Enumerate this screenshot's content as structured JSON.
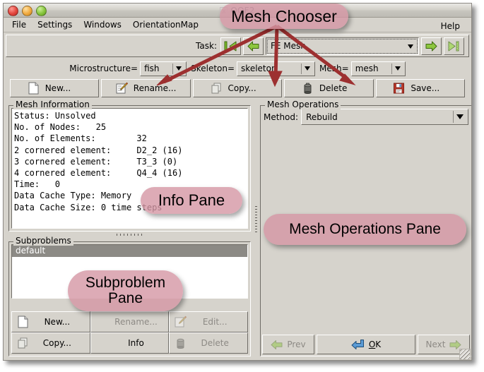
{
  "window": {
    "title_icon": "x-icon",
    "title": "OOF2",
    "lights": [
      "close-light",
      "minimize-light",
      "maximize-light"
    ]
  },
  "menubar": {
    "items": [
      {
        "label": "File",
        "name": "menu-file"
      },
      {
        "label": "Settings",
        "name": "menu-settings"
      },
      {
        "label": "Windows",
        "name": "menu-windows"
      },
      {
        "label": "OrientationMap",
        "name": "menu-orientationmap"
      }
    ],
    "help": "Help"
  },
  "task_bar": {
    "label": "Task:",
    "value": "FE Mesh",
    "buttons": [
      {
        "name": "task-first-button",
        "icon": "arrow-first-icon"
      },
      {
        "name": "task-prev-button",
        "icon": "arrow-left-icon"
      },
      {
        "name": "task-next-button",
        "icon": "arrow-right-icon"
      },
      {
        "name": "task-last-button",
        "icon": "arrow-last-icon"
      }
    ]
  },
  "choosers": [
    {
      "label": "Microstructure=",
      "value": "fish",
      "name": "microstructure-chooser",
      "width": 66
    },
    {
      "label": "Skeleton=",
      "value": "skeleton",
      "name": "skeleton-chooser",
      "width": 111
    },
    {
      "label": "Mesh=",
      "value": "mesh",
      "name": "mesh-chooser",
      "width": 77
    }
  ],
  "mesh_buttons": [
    {
      "label": "New...",
      "icon": "new-document-icon",
      "name": "mesh-new-button"
    },
    {
      "label": "Rename...",
      "icon": "pencil-edit-icon",
      "name": "mesh-rename-button"
    },
    {
      "label": "Copy...",
      "icon": "copy-icon",
      "name": "mesh-copy-button",
      "disabled": true
    },
    {
      "label": "Delete",
      "icon": "trash-icon",
      "name": "mesh-delete-button"
    },
    {
      "label": "Save...",
      "icon": "floppy-save-icon",
      "name": "mesh-save-button"
    }
  ],
  "mesh_information": {
    "legend": "Mesh Information",
    "text": "Status: Unsolved\nNo. of Nodes:   25\nNo. of Elements:        32\n2 cornered element:     D2_2 (16)\n3 cornered element:     T3_3 (0)\n4 cornered element:     Q4_4 (16)\nTime:   0\nData Cache Type: Memory\nData Cache Size: 0 time steps"
  },
  "subproblems": {
    "legend": "Subproblems",
    "rows": [
      {
        "label": "default",
        "selected": true
      }
    ],
    "buttons": [
      {
        "label": "New...",
        "icon": "new-document-icon",
        "name": "subproblem-new-button",
        "disabled": false
      },
      {
        "label": "Rename...",
        "icon": "",
        "name": "subproblem-rename-button",
        "disabled": true
      },
      {
        "label": "Edit...",
        "icon": "pencil-edit-icon",
        "name": "subproblem-edit-button",
        "disabled": true
      },
      {
        "label": "Copy...",
        "icon": "copy-icon",
        "name": "subproblem-copy-button",
        "disabled": false
      },
      {
        "label": "Info",
        "icon": "",
        "name": "subproblem-info-button",
        "disabled": false
      },
      {
        "label": "Delete",
        "icon": "trash-icon",
        "name": "subproblem-delete-button",
        "disabled": true
      }
    ]
  },
  "mesh_operations": {
    "legend": "Mesh Operations",
    "method_label": "Method:",
    "method_value": "Rebuild",
    "nav": {
      "prev": "Prev",
      "ok_underline": "O",
      "ok_rest": "K",
      "ok_full": "OK",
      "next": "Next"
    }
  },
  "annotations": [
    {
      "text": "Mesh Chooser",
      "name": "callout-mesh-chooser"
    },
    {
      "text": "Info Pane",
      "name": "callout-info-pane"
    },
    {
      "text": "Mesh Operations Pane",
      "name": "callout-mesh-operations-pane"
    },
    {
      "text": "Subproblem Pane",
      "name": "callout-subproblem-pane"
    }
  ],
  "colors": {
    "callout_fill": "#d496a4",
    "arrow": "#9d3030",
    "window_bg": "#d6d3cc",
    "selection": "#8c8a85",
    "green_arrow": "#8dc63f"
  }
}
